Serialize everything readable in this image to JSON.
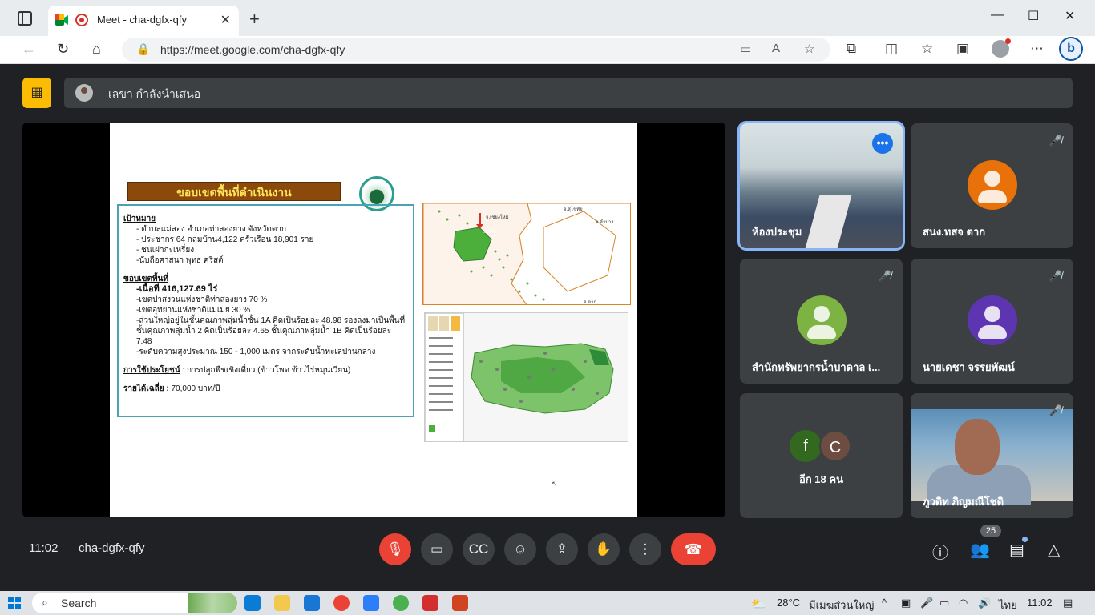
{
  "browser": {
    "tab_title": "Meet - cha-dgfx-qfy",
    "url": "https://meet.google.com/cha-dgfx-qfy"
  },
  "meet": {
    "presenting_text": "เลขา กำลังนำเสนอ",
    "time": "11:02",
    "meeting_code": "cha-dgfx-qfy",
    "participant_count": "25",
    "more_participants": "อีก 18 คน",
    "tiles": [
      {
        "name": "ห้องประชุม"
      },
      {
        "name": "สนง.ทสจ ตาก"
      },
      {
        "name": "สำนักทรัพยากรน้ำบาดาล เ..."
      },
      {
        "name": "นายเดชา จรรยพัฒน์"
      },
      {
        "name": "ภูวดิท ภิญมณีโชติ"
      }
    ],
    "more_avatars": [
      "f",
      "C"
    ],
    "colors": {
      "avatar_orange": "#e8710a",
      "avatar_green": "#7cb342",
      "avatar_purple": "#5e35b1",
      "avatar_f": "#33691e",
      "avatar_c": "#6d4c41"
    }
  },
  "slide": {
    "title": "ขอบเขตพื้นที่ดำเนินงาน",
    "goal_header": "เป้าหมาย",
    "goal_lines": [
      "- ตำบลแม่สอง อำเภอท่าสองยาง จังหวัดตาก",
      "- ประชากร 64 กลุ่มบ้าน4,122 ครัวเรือน 18,901 ราย",
      "- ชนเผ่ากะเหรี่ยง",
      "-นับถือศาสนา พุทธ คริสต์"
    ],
    "area_header": "ขอบเขตพื้นที่",
    "area_size": "-เนื้อที่ 416,127.69 ไร่",
    "area_lines": [
      "-เขตป่าสงวนแห่งชาติท่าสองยาง 70 %",
      "-เขตอุทยานแห่งชาติแม่เมย 30 %",
      "-ส่วนใหญ่อยู่ในชั้นคุณภาพลุ่มน้ำชั้น 1A คิดเป็นร้อยละ 48.98 รองลงมาเป็นพื้นที่ชั้นคุณภาพลุ่มน้ำ 2 คิดเป็นร้อยละ 4.65 ชั้นคุณภาพลุ่มน้ำ 1B คิดเป็นร้อยละ 7.48",
      "-ระดับความสูงประมาณ 150 - 1,000 เมตร จากระดับน้ำทะเลปานกลาง"
    ],
    "use_header": "การใช้ประโยชน์",
    "use_text": ": การปลูกพืชเชิงเดี่ยว (ข้าวโพด ข้าวไร่หมุนเวียน)",
    "income_header": "รายได้เฉลี่ย :",
    "income_text": "70,000 บาท/ปี",
    "map_labels": [
      "จ.เชียงใหม่",
      "แม่สอง",
      "จ.ลำปาง",
      "จ.สุโขทัย",
      "จ.ตาก"
    ]
  },
  "taskbar": {
    "search_placeholder": "Search",
    "weather": "28°C",
    "weather_desc": "มีเมฆส่วนใหญ่",
    "lang": "ไทย",
    "time": "11:02"
  }
}
